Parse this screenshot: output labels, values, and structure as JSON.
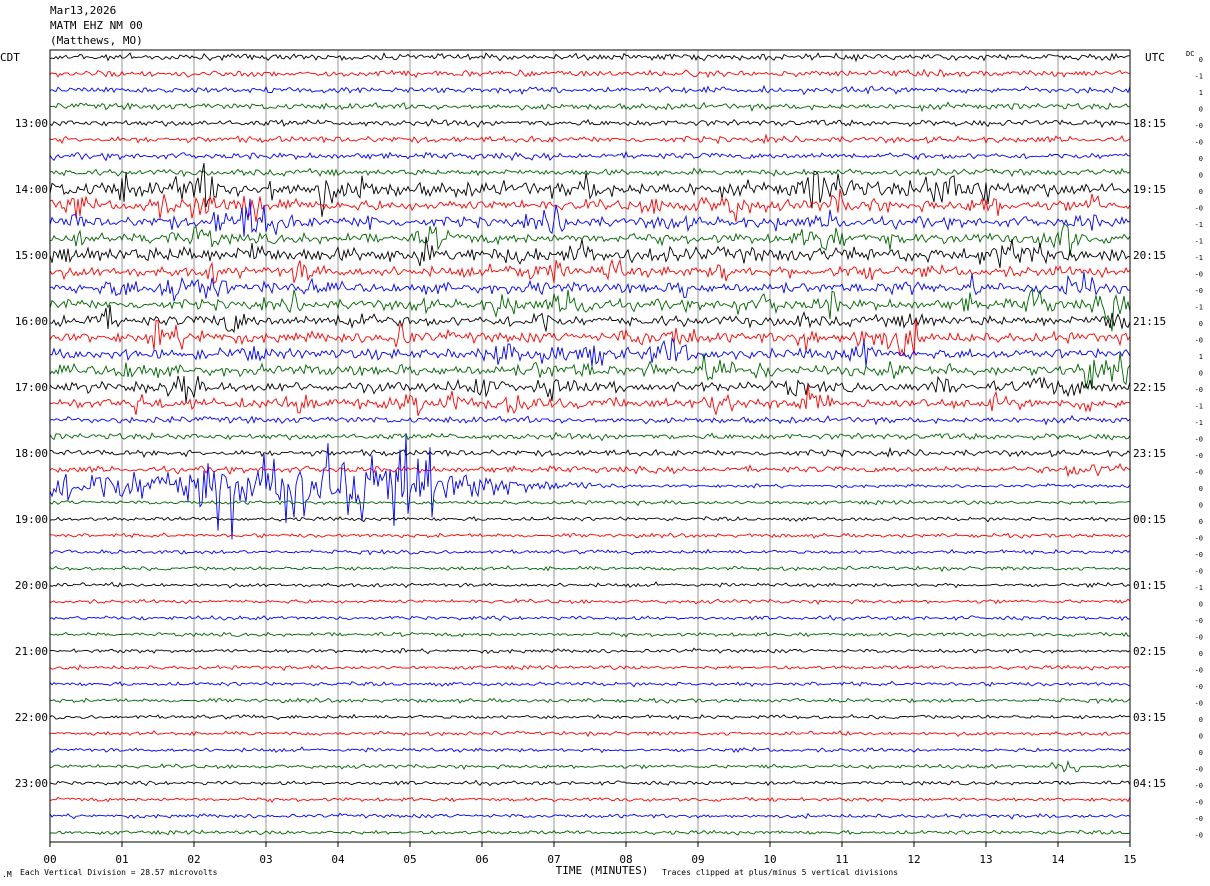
{
  "header": {
    "date": "Mar13,2026",
    "station": "MATM EHZ NM 00",
    "location": "(Matthews, MO)"
  },
  "left_tz": "CDT",
  "right_tz": "UTC",
  "dc_label": "DC",
  "footer": {
    "scale_note": "Each Vertical Division =   28.57 microvolts",
    "clip_note": "Traces clipped at plus/minus 5 vertical divisions",
    "corner_mark": ".M"
  },
  "colors": {
    "cycle": [
      "#000000",
      "#ff0000",
      "#0000ff",
      "#006400"
    ],
    "grid": "#7f7f7f"
  },
  "chart_data": {
    "type": "line",
    "title": "MATM EHZ NM 00 (Matthews, MO)",
    "xlabel": "TIME (MINUTES)",
    "ylabel": "",
    "xlim": [
      0,
      15
    ],
    "x_ticks": [
      "00",
      "01",
      "02",
      "03",
      "04",
      "05",
      "06",
      "07",
      "08",
      "09",
      "10",
      "11",
      "12",
      "13",
      "14",
      "15"
    ],
    "left_hour_labels": [
      "13:00",
      "14:00",
      "15:00",
      "16:00",
      "17:00",
      "18:00",
      "19:00",
      "20:00",
      "21:00",
      "22:00",
      "23:00"
    ],
    "right_hour_labels": [
      "18:15",
      "19:15",
      "20:15",
      "21:15",
      "22:15",
      "23:15",
      "00:15",
      "01:15",
      "02:15",
      "03:15",
      "04:15"
    ],
    "first_labeled_trace_index": 4,
    "traces_per_hour": 4,
    "trace_count": 48,
    "right_dc_values": [
      "0",
      "-1",
      "1",
      "0",
      "-0",
      "-0",
      "0",
      "0",
      "0",
      "-0",
      "-1",
      "-1",
      "-1",
      "-0",
      "-0",
      "-1",
      "0",
      "-0",
      "1",
      "0",
      "-0",
      "-1",
      "-1",
      "-0",
      "-0",
      "-0",
      "0",
      "0",
      "0",
      "-0",
      "-0",
      "-0",
      "-1",
      "0",
      "-0",
      "-0",
      "0",
      "-0",
      "-0",
      "-0",
      "0",
      "0",
      "0",
      "-0",
      "-0",
      "-0",
      "-0",
      "-0"
    ],
    "trace_activity_level": [
      2,
      2,
      2,
      2,
      2,
      2,
      2,
      2,
      4,
      3,
      3,
      3,
      4,
      3,
      3,
      3,
      3,
      3,
      3,
      3,
      3,
      3,
      2,
      2,
      2,
      2,
      2,
      1,
      1,
      1,
      1,
      1,
      1,
      1,
      1,
      1,
      1,
      1,
      1,
      1,
      1,
      1,
      1,
      1,
      1,
      1,
      1,
      1
    ],
    "event": {
      "trace_index": 26,
      "strong_motion_minutes": [
        0,
        5.4
      ],
      "coda_end_minute": 8.0,
      "clipped": true
    },
    "local_events": [
      {
        "trace_index": 25,
        "minute_range": [
          14.1,
          15.0
        ]
      },
      {
        "trace_index": 43,
        "minute_range": [
          13.9,
          14.3
        ]
      }
    ]
  }
}
